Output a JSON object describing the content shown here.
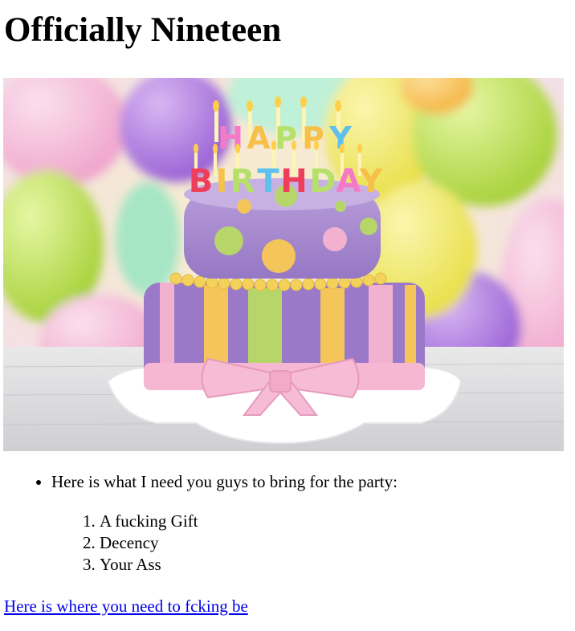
{
  "page": {
    "title": "Officially Nineteen"
  },
  "hero_image": {
    "subject": "birthday-cake-photo",
    "cake_topper_text": "HAPPY BIRTHDAY",
    "colors": {
      "lavender": "#a98bd0",
      "pink": "#f2b2cf",
      "yellow": "#f4c55a",
      "lime": "#b7d66a",
      "plate": "#ffffff"
    }
  },
  "bring_list": {
    "intro": "Here is what I need you guys to bring for the party:",
    "items": [
      "A fucking Gift",
      "Decency",
      "Your Ass"
    ]
  },
  "location_link": {
    "label": "Here is where you need to fcking be",
    "color": "#0000ee"
  }
}
